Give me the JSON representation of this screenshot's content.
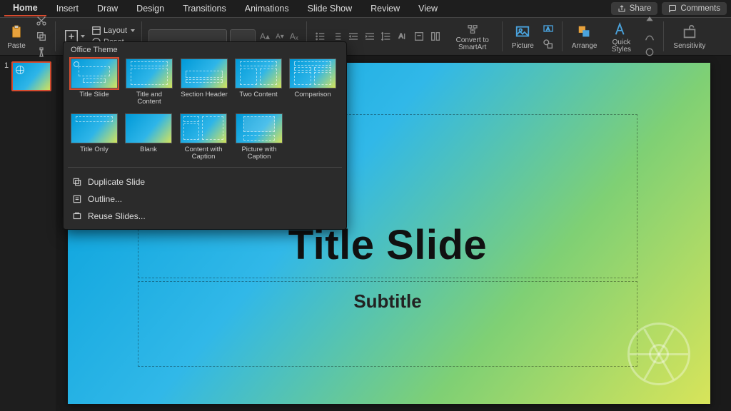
{
  "tabs": {
    "items": [
      "Home",
      "Insert",
      "Draw",
      "Design",
      "Transitions",
      "Animations",
      "Slide Show",
      "Review",
      "View"
    ],
    "active": 0
  },
  "header_buttons": {
    "share": "Share",
    "comments": "Comments"
  },
  "ribbon": {
    "paste": "Paste",
    "layout": "Layout",
    "reset": "Reset",
    "convert": "Convert to SmartArt",
    "picture": "Picture",
    "arrange": "Arrange",
    "quick_styles": "Quick Styles",
    "sensitivity": "Sensitivity"
  },
  "gallery": {
    "theme_label": "Office Theme",
    "layouts": [
      "Title Slide",
      "Title and Content",
      "Section Header",
      "Two Content",
      "Comparison",
      "Title Only",
      "Blank",
      "Content with Caption",
      "Picture with Caption"
    ],
    "menu": {
      "duplicate": "Duplicate Slide",
      "outline": "Outline...",
      "reuse": "Reuse Slides..."
    }
  },
  "slide": {
    "number": "1",
    "title": "Title Slide",
    "subtitle": "Subtitle"
  }
}
